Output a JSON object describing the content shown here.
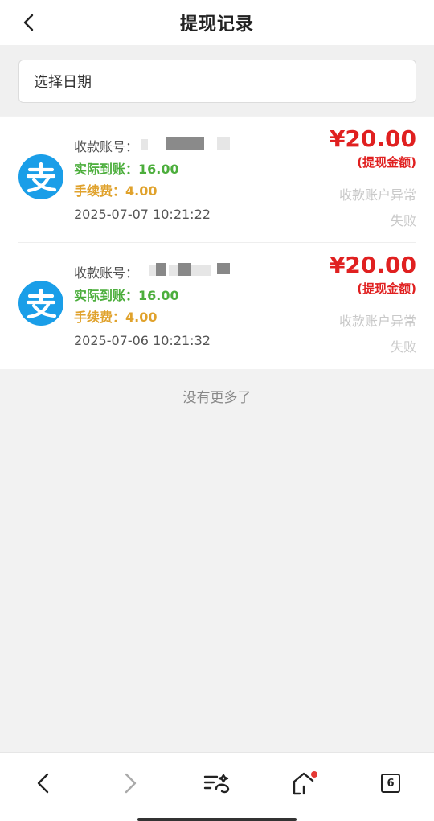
{
  "header": {
    "title": "提现记录"
  },
  "filter": {
    "date_label": "选择日期"
  },
  "records": [
    {
      "account_label": "收款账号：",
      "actual_label": "实际到账：",
      "actual_value": "16.00",
      "fee_label": "手续费：",
      "fee_value": "4.00",
      "time": "2025-07-07 10:21:22",
      "amount": "¥20.00",
      "amount_label": "(提现金额)",
      "status_line1": "收款账户异常",
      "status_line2": "失败"
    },
    {
      "account_label": "收款账号：",
      "actual_label": "实际到账：",
      "actual_value": "16.00",
      "fee_label": "手续费：",
      "fee_value": "4.00",
      "time": "2025-07-06 10:21:32",
      "amount": "¥20.00",
      "amount_label": "(提现金额)",
      "status_line1": "收款账户异常",
      "status_line2": "失败"
    }
  ],
  "footer": {
    "no_more": "没有更多了"
  },
  "browser_nav": {
    "tab_count": "6",
    "icons": [
      "back-icon",
      "forward-icon",
      "menu-icon",
      "home-icon",
      "tabs-icon"
    ],
    "notification_color": "#e53935"
  },
  "colors": {
    "amount": "#e02020",
    "actual": "#4cae3c",
    "fee": "#e0a22c",
    "alipay": "#1a9ee8"
  }
}
